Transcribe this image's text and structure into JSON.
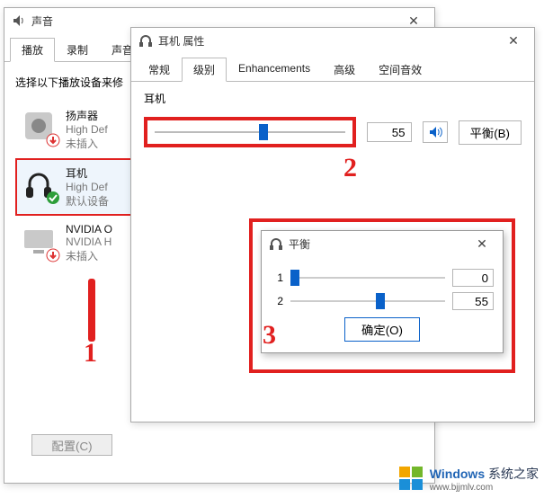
{
  "sound": {
    "title": "声音",
    "tabs": {
      "playback": "播放",
      "record": "录制",
      "voice": "声音"
    },
    "hint": "选择以下播放设备来修",
    "devices": [
      {
        "name": "扬声器",
        "sub1": "High Def",
        "sub2": "未插入"
      },
      {
        "name": "耳机",
        "sub1": "High Def",
        "sub2": "默认设备"
      },
      {
        "name": "NVIDIA O",
        "sub1": "NVIDIA H",
        "sub2": "未插入"
      }
    ],
    "configure": "配置(C)"
  },
  "prop": {
    "title": "耳机 属性",
    "tabs": {
      "general": "常规",
      "levels": "级别",
      "enh": "Enhancements",
      "adv": "高级",
      "spatial": "空间音效"
    },
    "level": {
      "label": "耳机",
      "value": "55",
      "balance_btn": "平衡(B)"
    }
  },
  "balance": {
    "title": "平衡",
    "rows": [
      {
        "label": "1",
        "value": "0",
        "pos": 0
      },
      {
        "label": "2",
        "value": "55",
        "pos": 55
      }
    ],
    "ok": "确定(O)"
  },
  "annotations": {
    "n1": "1",
    "n2": "2",
    "n3": "3"
  },
  "watermark": {
    "brand": "Windows",
    "suffix": "系统之家",
    "url": "www.bjjmlv.com"
  }
}
